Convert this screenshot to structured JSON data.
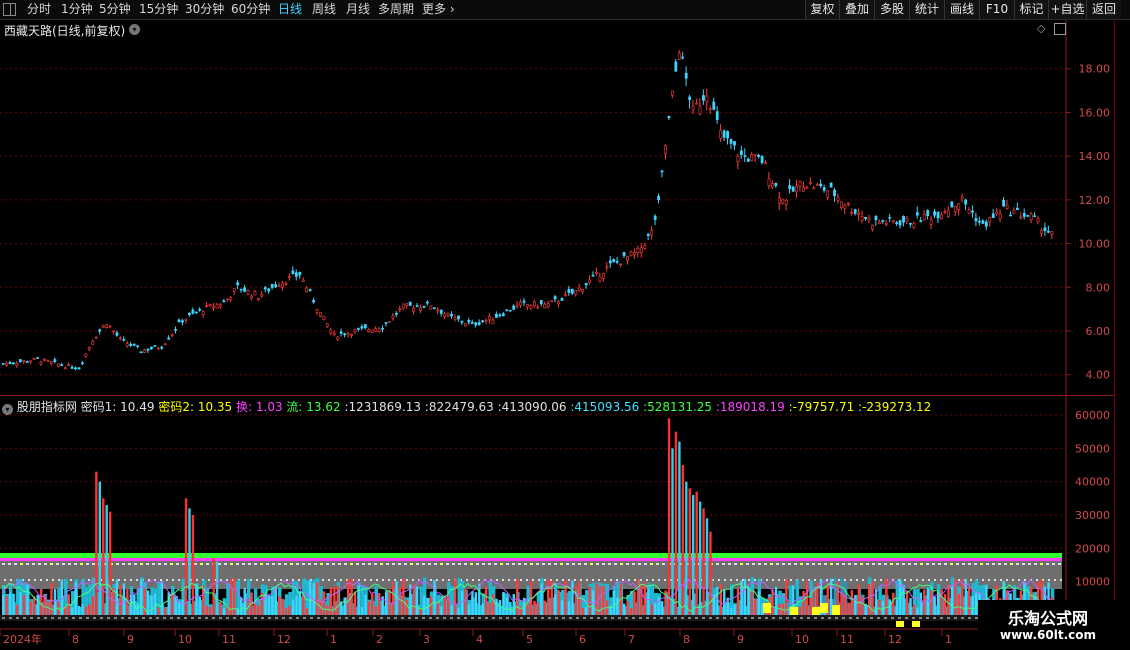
{
  "toolbar": {
    "periods": [
      "分时",
      "1分钟",
      "5分钟",
      "15分钟",
      "30分钟",
      "60分钟",
      "日线",
      "周线",
      "月线",
      "多周期",
      "更多"
    ],
    "active_period": "日线",
    "actions": [
      "复权",
      "叠加",
      "多股",
      "统计",
      "画线",
      "F10",
      "标记",
      "+自选",
      "返回"
    ]
  },
  "stock_title": "西藏天路(日线,前复权)",
  "price_axis": [
    "18.00",
    "16.00",
    "14.00",
    "12.00",
    "10.00",
    "8.00",
    "6.00",
    "4.00"
  ],
  "indicator": {
    "name": "股朋指标网",
    "values": [
      {
        "label": "密码1",
        "value": "10.49",
        "color": "#e0e0e0"
      },
      {
        "label": "密码2",
        "value": "10.35",
        "color": "#ffff00"
      },
      {
        "label": "换",
        "value": "1.03",
        "color": "#ff40ff"
      },
      {
        "label": "流",
        "value": "13.62",
        "color": "#40ff40"
      },
      {
        "label": "",
        "value": "1231869.13",
        "color": "#e0e0e0"
      },
      {
        "label": "",
        "value": "822479.63",
        "color": "#e0e0e0"
      },
      {
        "label": "",
        "value": "413090.06",
        "color": "#e0e0e0"
      },
      {
        "label": "",
        "value": "415093.56",
        "color": "#40e0ff"
      },
      {
        "label": "",
        "value": "528131.25",
        "color": "#40ff40"
      },
      {
        "label": "",
        "value": "189018.19",
        "color": "#ff40ff"
      },
      {
        "label": "",
        "value": "-79757.71",
        "color": "#ffff00"
      },
      {
        "label": "",
        "value": "-239273.12",
        "color": "#ffff00"
      }
    ],
    "axis": [
      "60000",
      "50000",
      "40000",
      "30000",
      "20000",
      "10000"
    ]
  },
  "x_axis": [
    "2024年",
    "8",
    "9",
    "10",
    "11",
    "12",
    "1",
    "2",
    "3",
    "4",
    "5",
    "6",
    "7",
    "8",
    "9",
    "10",
    "11",
    "12",
    "1"
  ],
  "watermark": {
    "line1": "乐淘公式网",
    "line2": "www.60lt.com"
  },
  "colors": {
    "up": "#ff3c3c",
    "down": "#3fd5ff",
    "grid": "#6a0000",
    "axis_text": "#d24a4a"
  }
}
